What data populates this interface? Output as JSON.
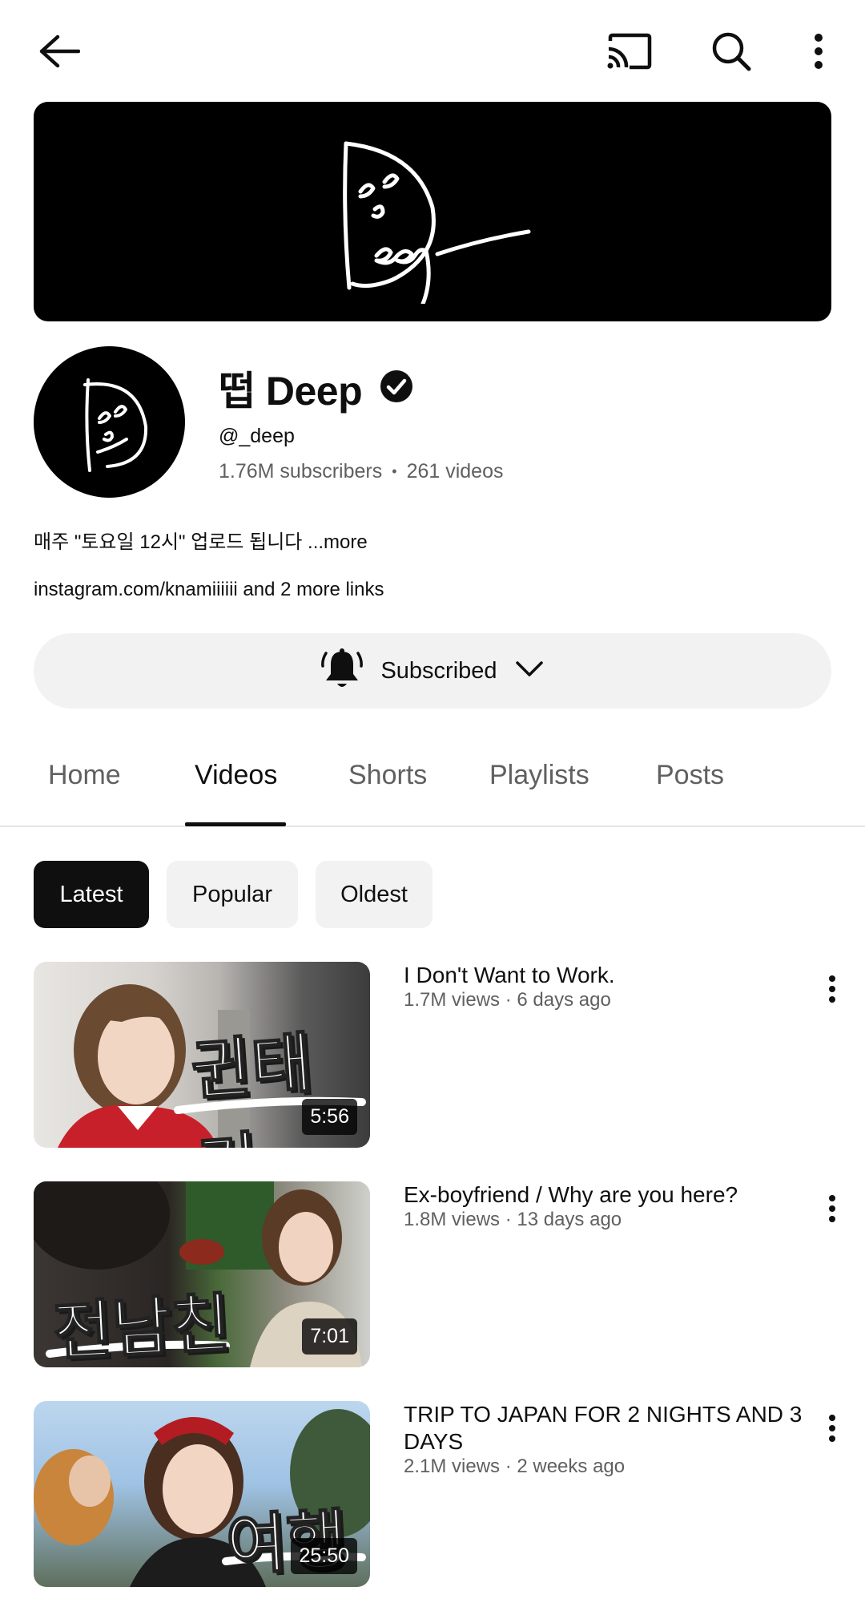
{
  "header": {
    "back_icon": "arrow-left-icon",
    "cast_icon": "cast-icon",
    "search_icon": "search-icon",
    "more_icon": "more-vert-icon"
  },
  "banner": {
    "logo_alt": "Deep"
  },
  "channel": {
    "name": "떱 Deep",
    "verified_icon": "verified-check-icon",
    "handle": "@_deep",
    "subscribers": "1.76M subscribers",
    "videos": "261 videos",
    "separator": "•",
    "description": "매주 \"토요일 12시\" 업로드 됩니다",
    "description_more": " ...more",
    "links": "instagram.com/knamiiiiii and 2 more links"
  },
  "subscribe": {
    "label": "Subscribed",
    "bell_icon": "bell-icon",
    "chevron_icon": "chevron-down-icon"
  },
  "tabs": [
    {
      "label": "Home"
    },
    {
      "label": "Videos",
      "active": true
    },
    {
      "label": "Shorts"
    },
    {
      "label": "Playlists"
    },
    {
      "label": "Posts"
    }
  ],
  "chips": [
    {
      "label": "Latest",
      "active": true
    },
    {
      "label": "Popular"
    },
    {
      "label": "Oldest"
    }
  ],
  "videos": [
    {
      "title": "I Don't Want to Work.",
      "meta": "1.7M views · 6 days ago",
      "duration": "5:56",
      "thumb_text": "귄태기"
    },
    {
      "title": "Ex-boyfriend / Why are you here?",
      "meta": "1.8M views · 13 days ago",
      "duration": "7:01",
      "thumb_text": "전남친"
    },
    {
      "title": "TRIP TO JAPAN FOR 2 NIGHTS AND 3 DAYS",
      "meta": "2.1M views · 2 weeks ago",
      "duration": "25:50",
      "thumb_text": "여행"
    }
  ]
}
